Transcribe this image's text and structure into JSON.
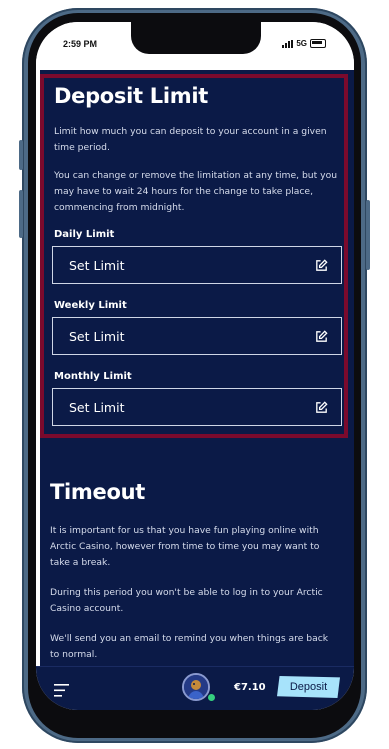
{
  "status_bar": {
    "time": "2:59 PM",
    "network": "5G"
  },
  "deposit_limit": {
    "title": "Deposit Limit",
    "paragraph_1": "Limit how much you can deposit to your account in a given time period.",
    "paragraph_2": "You can change or remove the limitation at any time, but you may have to wait 24 hours for the change to take place, commencing from midnight.",
    "limits": [
      {
        "label": "Daily Limit",
        "value": "Set Limit",
        "icon": "edit-icon"
      },
      {
        "label": "Weekly Limit",
        "value": "Set Limit",
        "icon": "edit-icon"
      },
      {
        "label": "Monthly Limit",
        "value": "Set Limit",
        "icon": "edit-icon"
      }
    ]
  },
  "timeout": {
    "title": "Timeout",
    "paragraph_1": "It is important for us that you have fun playing online with Arctic Casino, however from time to time you may want to take a break.",
    "paragraph_2": "During this period you won't be able to log in to your Arctic Casino account.",
    "paragraph_3": "We'll send you an email to remind you when things are back to normal."
  },
  "bottom_bar": {
    "menu_icon": "hamburger-menu-icon",
    "balance": "€7.10",
    "deposit_label": "Deposit"
  },
  "colors": {
    "background": "#0b1a47",
    "highlight_border": "#7b0a2d",
    "deposit_button": "#a7e3fb",
    "online_dot": "#35d07f"
  }
}
